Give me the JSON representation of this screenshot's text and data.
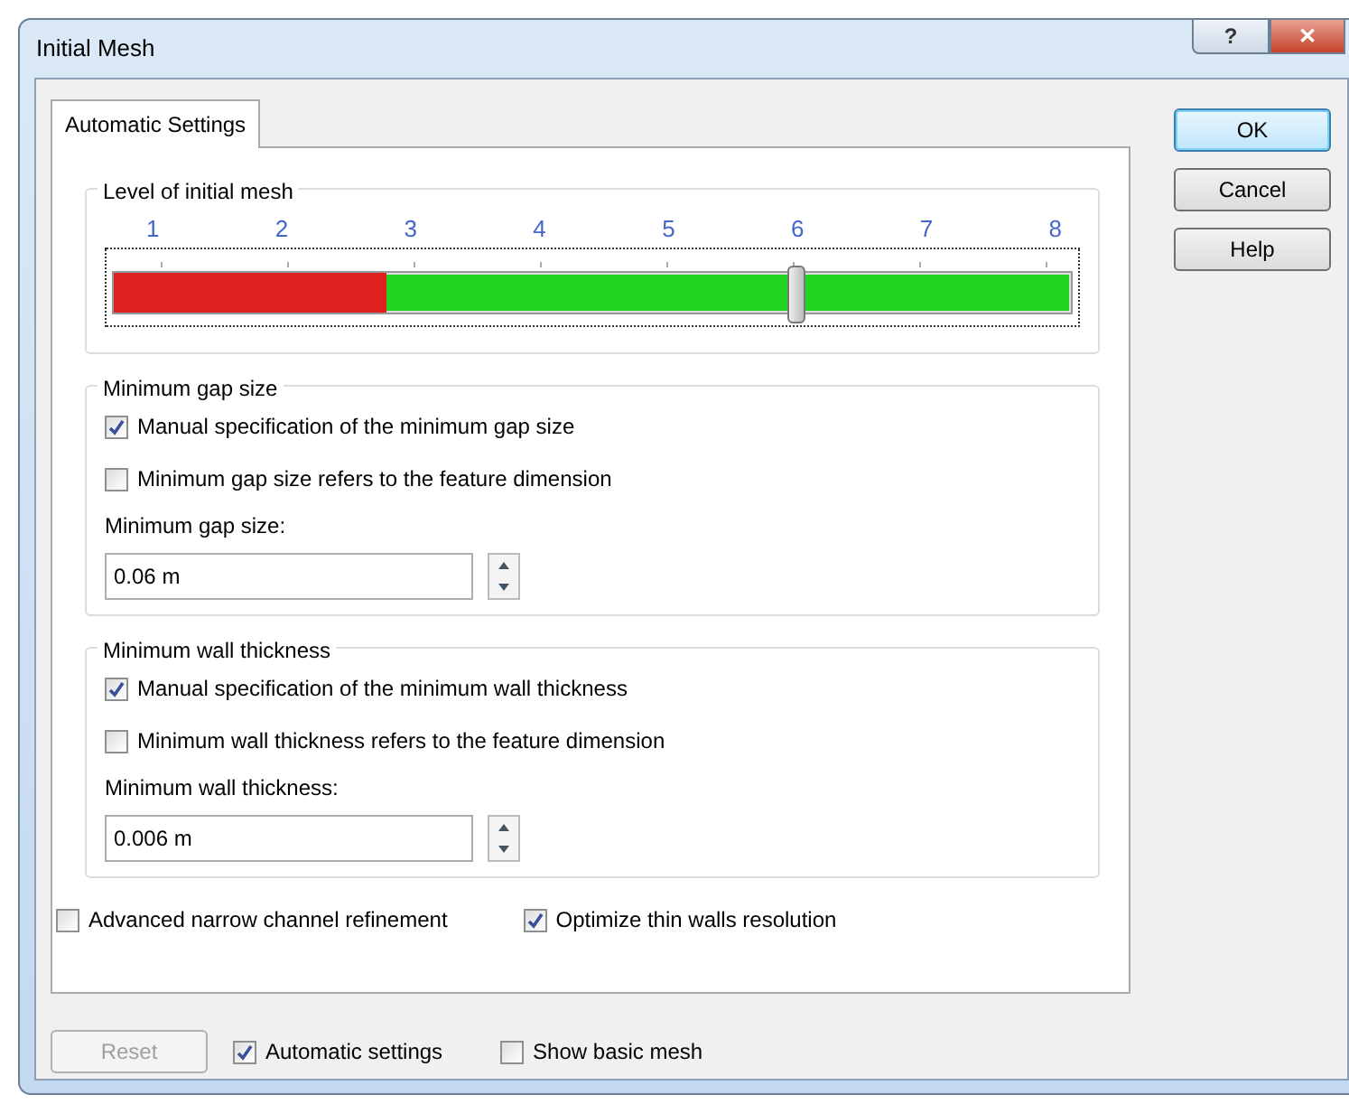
{
  "window": {
    "title": "Initial Mesh",
    "caption_buttons": [
      "?",
      "✕"
    ]
  },
  "tabs": [
    {
      "label": "Automatic Settings",
      "selected": true
    }
  ],
  "level_group": {
    "title": "Level of initial mesh",
    "ticks": [
      "1",
      "2",
      "3",
      "4",
      "5",
      "6",
      "7",
      "8"
    ],
    "slider": {
      "level": 0.714,
      "low_zone": {
        "level": 0.2857
      }
    }
  },
  "groups": [
    {
      "title": "Minimum gap size",
      "checks": [
        {
          "label": "Manual specification of the minimum gap size",
          "checked": true
        },
        {
          "label": "Minimum gap size refers to the feature dimension",
          "checked": false
        }
      ],
      "field_label": "Minimum gap size:",
      "value": "0.06 m"
    },
    {
      "title": "Minimum wall thickness",
      "checks": [
        {
          "label": "Manual specification of the minimum wall thickness",
          "checked": true
        },
        {
          "label": "Minimum wall thickness refers to the feature dimension",
          "checked": false
        }
      ],
      "field_label": "Minimum wall thickness:",
      "value": "0.006 m"
    }
  ],
  "panel_checks": [
    {
      "label": "Advanced narrow channel refinement",
      "checked": false
    },
    {
      "label": "Optimize thin walls resolution",
      "checked": true
    }
  ],
  "side_buttons": [
    {
      "label": "OK",
      "default": true
    },
    {
      "label": "Cancel",
      "default": false
    },
    {
      "label": "Help",
      "default": false
    }
  ],
  "footer": {
    "reset": {
      "label": "Reset",
      "disabled": true
    },
    "checks": [
      {
        "label": "Automatic settings",
        "checked": true
      },
      {
        "label": "Show basic mesh",
        "checked": false
      }
    ]
  }
}
